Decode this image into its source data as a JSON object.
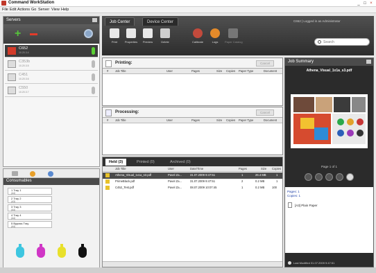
{
  "app": {
    "title": "Command WorkStation"
  },
  "menu": [
    "File",
    "Edit",
    "Actions",
    "Go",
    "Server",
    "View",
    "Help"
  ],
  "window_controls": [
    "_",
    "□",
    "×"
  ],
  "servers": {
    "title": "Servers",
    "items": [
      {
        "name": "C652",
        "sub": "10.20.3.4",
        "selected": true
      },
      {
        "name": "C353b",
        "sub": "10.20.3.5",
        "selected": false
      },
      {
        "name": "C451",
        "sub": "10.20.3.6",
        "selected": false
      },
      {
        "name": "C550",
        "sub": "10.20.3.7",
        "selected": false
      }
    ]
  },
  "consumables": {
    "title": "Consumables",
    "trays": [
      {
        "name": "1 Tray 1",
        "size": "(A4)"
      },
      {
        "name": "2 Tray 2",
        "size": "(A3)"
      },
      {
        "name": "3 Tray 3",
        "size": "(A4)"
      },
      {
        "name": "4 Tray 4",
        "size": "(A4)"
      },
      {
        "name": "5 Bypass Tray",
        "size": "(A4)"
      }
    ],
    "toner_colors": [
      "#3ec6e0",
      "#d036c6",
      "#e8e02b",
      "#111111"
    ]
  },
  "header": {
    "tabs": [
      "Job Center",
      "Device Center"
    ],
    "login_text": "C652 | Logged in as Administrator",
    "search_placeholder": "Search"
  },
  "toolbar": [
    {
      "label": "Print",
      "icon": "printer-icon",
      "color": "#e8e8e8"
    },
    {
      "label": "Properties",
      "icon": "properties-icon",
      "color": "#e8e8e8"
    },
    {
      "label": "Preview",
      "icon": "preview-icon",
      "color": "#e8e8e8"
    },
    {
      "label": "Delete",
      "icon": "delete-icon",
      "color": "#cfcfcf"
    },
    {
      "label": "Calibrate",
      "icon": "calibrate-icon",
      "color": "#c24a3c"
    },
    {
      "label": "Logs",
      "icon": "logs-icon",
      "color": "#e48a2a"
    },
    {
      "label": "Paper Catalog",
      "icon": "paper-catalog-icon",
      "color": "#777777"
    }
  ],
  "printing": {
    "title": "Printing:",
    "cancel_label": "Cancel",
    "columns": [
      "#",
      "Job Title",
      "User",
      "Pages",
      "Size",
      "Copies",
      "Paper Type",
      "Document"
    ]
  },
  "processing": {
    "title": "Processing:",
    "cancel_label": "Cancel",
    "columns": [
      "#",
      "Job Title",
      "User",
      "Pages",
      "Size",
      "Copies",
      "Paper Type",
      "Document"
    ]
  },
  "jobs": {
    "tabs": [
      "Held (3)",
      "Printed (0)",
      "Archived (0)"
    ],
    "columns": [
      "Job Title",
      "User",
      "Date/Time",
      "Pages",
      "Size",
      "Copies"
    ],
    "rows": [
      {
        "title": "Athena_Visual_1x1a_s3.pdf",
        "user": "Pavel Za...",
        "date": "31.07.2009 9:47:51",
        "pages": "1",
        "size": "26.4 MB",
        "copies": "1",
        "selected": true
      },
      {
        "title": "PrimeBlack.pdf",
        "user": "Pavel Za...",
        "date": "31.07.2009 9:47:51",
        "pages": "2",
        "size": "0.2 MB",
        "copies": "1",
        "selected": false
      },
      {
        "title": "C452_Test.pdf",
        "user": "Pavel Za...",
        "date": "08.07.2009 10:07:45",
        "pages": "1",
        "size": "0.2 MB",
        "copies": "100",
        "selected": false
      }
    ]
  },
  "summary": {
    "title": "Job Summary",
    "file": "Athena_Visual_1x1a_s3.pdf",
    "page": "Page 1 of 1",
    "pages": "Pages: 1",
    "copies": "Copies: 1",
    "paper": "[A3] Plain Paper",
    "modified": "Last Modified 31.07.2009 9:47:51"
  }
}
